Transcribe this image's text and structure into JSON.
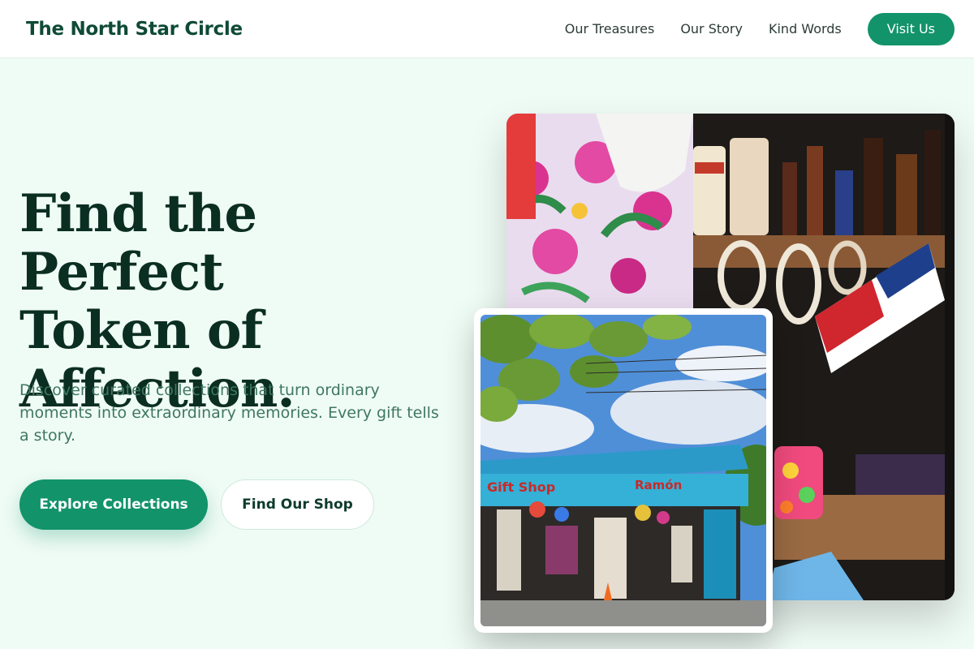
{
  "header": {
    "brand": "The North Star Circle",
    "nav": [
      "Our Treasures",
      "Our Story",
      "Kind Words"
    ],
    "cta": "Visit Us"
  },
  "hero": {
    "title_lines": [
      "Find the Perfect",
      "Token of",
      "Affection."
    ],
    "subtitle": "Discover curated collections that turn ordinary moments into extraordinary memories. Every gift tells a story.",
    "primary_button": "Explore Collections",
    "secondary_button": "Find Our Shop"
  },
  "images": {
    "main": {
      "description_icon": "market-stall-photo",
      "alt": ""
    },
    "inset": {
      "description_icon": "gift-shop-photo",
      "shop_sign": "Gift Shop",
      "shop_sign_right": "Ramón"
    }
  },
  "colors": {
    "accent": "#13936a",
    "heading": "#0b2e22",
    "brand": "#0f4a37",
    "subtitle": "#3f7763",
    "background": "#effbf5"
  }
}
